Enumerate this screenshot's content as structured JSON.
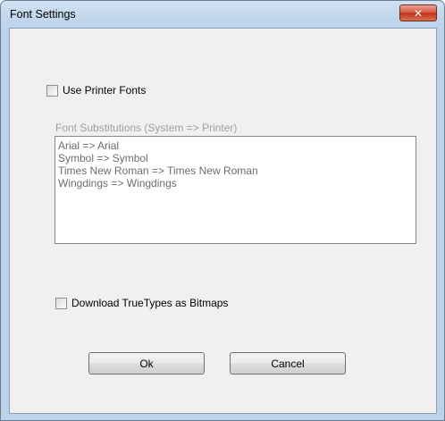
{
  "window": {
    "title": "Font Settings"
  },
  "close_icon": "close-icon",
  "use_printer_fonts": {
    "label": "Use Printer Fonts",
    "checked": false
  },
  "substitutions": {
    "label": "Font Substitutions (System => Printer)",
    "items": [
      "Arial => Arial",
      "Symbol => Symbol",
      "Times New Roman => Times New Roman",
      "Wingdings => Wingdings"
    ]
  },
  "download_truetypes": {
    "label": "Download TrueTypes as Bitmaps",
    "checked": false
  },
  "buttons": {
    "ok": "Ok",
    "cancel": "Cancel"
  },
  "colors": {
    "close_button": "#c0331b",
    "frame": "#bcd3ea",
    "disabled_text": "#a0a0a0"
  }
}
